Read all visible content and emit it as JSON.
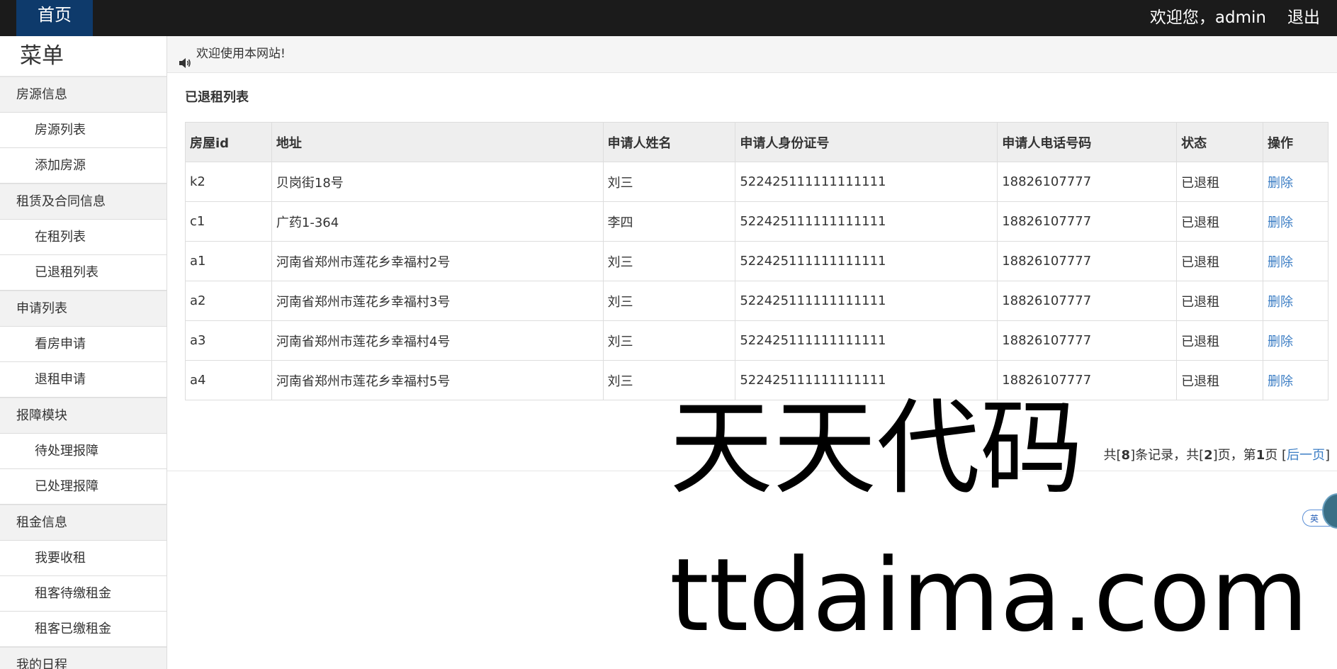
{
  "navbar": {
    "home_label": "首页",
    "welcome_text": "欢迎您，admin",
    "logout_label": "退出"
  },
  "sidebar": {
    "title": "菜单",
    "groups": [
      {
        "label": "房源信息",
        "items": [
          "房源列表",
          "添加房源"
        ]
      },
      {
        "label": "租赁及合同信息",
        "items": [
          "在租列表",
          "已退租列表"
        ]
      },
      {
        "label": "申请列表",
        "items": [
          "看房申请",
          "退租申请"
        ]
      },
      {
        "label": "报障模块",
        "items": [
          "待处理报障",
          "已处理报障"
        ]
      },
      {
        "label": "租金信息",
        "items": [
          "我要收租",
          "租客待缴租金",
          "租客已缴租金"
        ]
      },
      {
        "label": "我的日程",
        "items": []
      }
    ]
  },
  "notice": {
    "icon": "speaker-icon",
    "text": "欢迎使用本网站!"
  },
  "panel": {
    "title": "已退租列表"
  },
  "table": {
    "headers": [
      "房屋id",
      "地址",
      "申请人姓名",
      "申请人身份证号",
      "申请人电话号码",
      "状态",
      "操作"
    ],
    "rows": [
      [
        "k2",
        "贝岗街18号",
        "刘三",
        "522425111111111111",
        "18826107777",
        "已退租",
        "删除"
      ],
      [
        "c1",
        "广药1-364",
        "李四",
        "522425111111111111",
        "18826107777",
        "已退租",
        "删除"
      ],
      [
        "a1",
        "河南省郑州市莲花乡幸福村2号",
        "刘三",
        "522425111111111111",
        "18826107777",
        "已退租",
        "删除"
      ],
      [
        "a2",
        "河南省郑州市莲花乡幸福村3号",
        "刘三",
        "522425111111111111",
        "18826107777",
        "已退租",
        "删除"
      ],
      [
        "a3",
        "河南省郑州市莲花乡幸福村4号",
        "刘三",
        "522425111111111111",
        "18826107777",
        "已退租",
        "删除"
      ],
      [
        "a4",
        "河南省郑州市莲花乡幸福村5号",
        "刘三",
        "522425111111111111",
        "18826107777",
        "已退租",
        "删除"
      ]
    ]
  },
  "pager": {
    "prefix": "共[",
    "total": "8",
    "mid1": "]条记录，共[",
    "pages": "2",
    "mid2": "]页，第",
    "current": "1",
    "mid3": "页 [",
    "next_label": "后一页",
    "suffix": "]"
  },
  "watermark": {
    "line1": "天天代码",
    "line2": "ttdaima.com"
  },
  "ime": {
    "label": "英"
  }
}
